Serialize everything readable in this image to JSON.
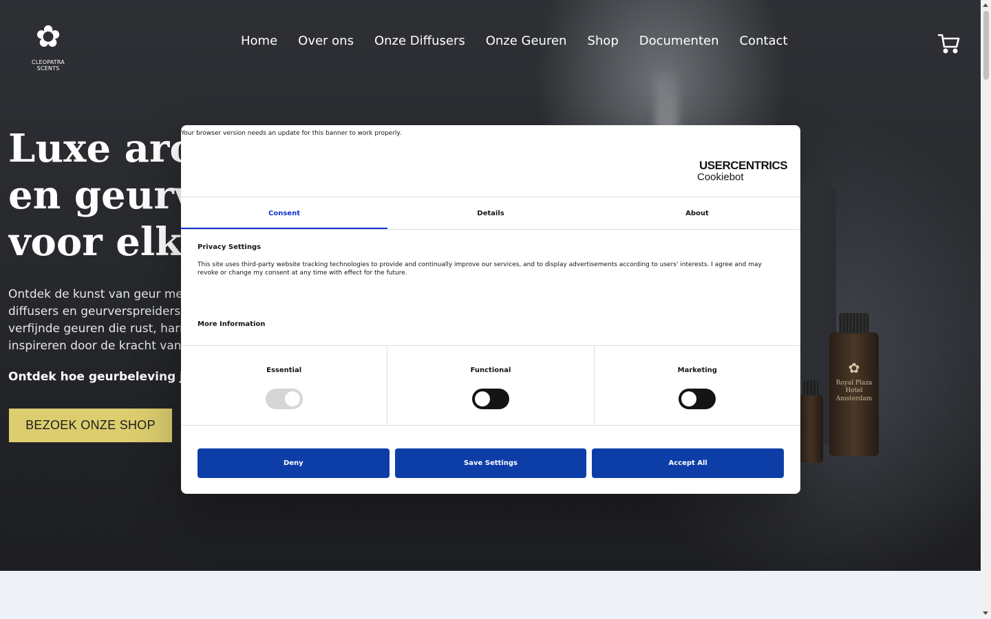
{
  "brand": {
    "logo_text": "CLEOPATRA SCENTS",
    "logo_icon": "orchid-flower-icon"
  },
  "nav": {
    "items": [
      "Home",
      "Over ons",
      "Onze Diffusers",
      "Onze Geuren",
      "Shop",
      "Documenten",
      "Contact"
    ],
    "cart_icon": "shopping-cart-icon"
  },
  "hero": {
    "title_lines": [
      "Luxe aron",
      "en geurve",
      "voor elke"
    ],
    "description_lines": [
      "Ontdek de kunst van geur met",
      "diffusers en geurverspreiders",
      "verfijnde geuren die rust, harm",
      "inspireren door de kracht van"
    ],
    "strong_line": "Ontdek hoe geurbeleving jou",
    "cta_label": "BEZOEK ONZE SHOP",
    "bottle_label_1": "Royal Plaza",
    "bottle_label_2": "Hotel Amsterdam"
  },
  "cookie": {
    "warning": "Your browser version needs an update for this banner to work properly.",
    "brand_top": "USERCENTRICS",
    "brand_bottom": "Cookiebot",
    "tabs": [
      "Consent",
      "Details",
      "About"
    ],
    "heading": "Privacy Settings",
    "body": "This site uses third-party website tracking technologies to provide and continually improve our services, and to display advertisements according to users' interests. I agree and may revoke or change my consent at any time with effect for the future.",
    "more_info": "More Information",
    "categories": [
      {
        "label": "Essential",
        "enabled": true,
        "locked": true
      },
      {
        "label": "Functional",
        "enabled": false,
        "locked": false
      },
      {
        "label": "Marketing",
        "enabled": false,
        "locked": false
      }
    ],
    "buttons": {
      "deny": "Deny",
      "save": "Save Settings",
      "accept": "Accept All"
    },
    "accent_color": "#0d3ea8"
  }
}
